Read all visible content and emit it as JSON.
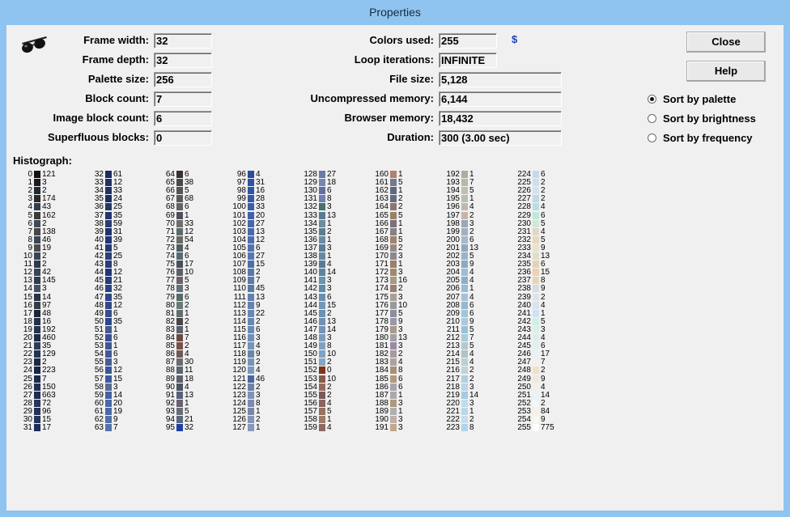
{
  "window": {
    "title": "Properties"
  },
  "fields_left": [
    {
      "label": "Frame width:",
      "value": "32"
    },
    {
      "label": "Frame depth:",
      "value": "32"
    },
    {
      "label": "Palette size:",
      "value": "256"
    },
    {
      "label": "Block count:",
      "value": "7"
    },
    {
      "label": "Image block count:",
      "value": "6"
    },
    {
      "label": "Superfluous blocks:",
      "value": "0"
    }
  ],
  "fields_mid": [
    {
      "label": "Colors used:",
      "value": "255"
    },
    {
      "label": "Loop iterations:",
      "value": "INFINITE"
    },
    {
      "label": "File size:",
      "value": "5,128"
    },
    {
      "label": "Uncompressed memory:",
      "value": "6,144"
    },
    {
      "label": "Browser memory:",
      "value": "18,432"
    },
    {
      "label": "Duration:",
      "value": "300 (3.00 sec)"
    }
  ],
  "dollar": "$",
  "buttons": {
    "close": "Close",
    "help": "Help"
  },
  "sort": {
    "selected": "palette",
    "options": [
      "Sort by palette",
      "Sort by brightness",
      "Sort by frequency"
    ]
  },
  "histograph": {
    "title": "Histograph:",
    "entries": [
      [
        "0",
        "#111111",
        "121"
      ],
      [
        "1",
        "#1c1c1c",
        "3"
      ],
      [
        "2",
        "#222a33",
        "2"
      ],
      [
        "3",
        "#2a2a2a",
        "174"
      ],
      [
        "4",
        "#333e4c",
        "43"
      ],
      [
        "5",
        "#3a3a3a",
        "162"
      ],
      [
        "6",
        "#404a58",
        "2"
      ],
      [
        "7",
        "#474747",
        "138"
      ],
      [
        "8",
        "#3d4656",
        "46"
      ],
      [
        "9",
        "#4c4c4c",
        "19"
      ],
      [
        "10",
        "#39464f",
        "2"
      ],
      [
        "11",
        "#2c3a4a",
        "2"
      ],
      [
        "12",
        "#374554",
        "42"
      ],
      [
        "13",
        "#2e3c52",
        "145"
      ],
      [
        "14",
        "#445264",
        "3"
      ],
      [
        "15",
        "#2b3542",
        "14"
      ],
      [
        "16",
        "#353c46",
        "97"
      ],
      [
        "17",
        "#1c2633",
        "48"
      ],
      [
        "18",
        "#22324a",
        "16"
      ],
      [
        "19",
        "#26344c",
        "192"
      ],
      [
        "20",
        "#1f2b44",
        "460"
      ],
      [
        "21",
        "#2c3b56",
        "35"
      ],
      [
        "22",
        "#243352",
        "129"
      ],
      [
        "23",
        "#1e2a45",
        "2"
      ],
      [
        "24",
        "#1a2645",
        "223"
      ],
      [
        "25",
        "#1d2b52",
        "7"
      ],
      [
        "26",
        "#222f52",
        "150"
      ],
      [
        "27",
        "#1f2c4f",
        "663"
      ],
      [
        "28",
        "#283459",
        "72"
      ],
      [
        "29",
        "#233057",
        "96"
      ],
      [
        "30",
        "#27335b",
        "15"
      ],
      [
        "31",
        "#1e2c5c",
        "17"
      ],
      [
        "32",
        "#1c2c60",
        "61"
      ],
      [
        "33",
        "#223160",
        "12"
      ],
      [
        "34",
        "#1f3367",
        "33"
      ],
      [
        "35",
        "#1b2d68",
        "24"
      ],
      [
        "36",
        "#263769",
        "25"
      ],
      [
        "37",
        "#22356d",
        "35"
      ],
      [
        "38",
        "#2c3c6c",
        "59"
      ],
      [
        "39",
        "#1e3270",
        "31"
      ],
      [
        "40",
        "#213674",
        "39"
      ],
      [
        "41",
        "#243a76",
        "5"
      ],
      [
        "42",
        "#2b3f78",
        "25"
      ],
      [
        "43",
        "#283c7a",
        "8"
      ],
      [
        "44",
        "#20367c",
        "12"
      ],
      [
        "45",
        "#263d80",
        "21"
      ],
      [
        "46",
        "#2b4284",
        "32"
      ],
      [
        "47",
        "#2e4686",
        "35"
      ],
      [
        "48",
        "#334a8a",
        "12"
      ],
      [
        "49",
        "#3a4f88",
        "6"
      ],
      [
        "50",
        "#2f478c",
        "35"
      ],
      [
        "51",
        "#475a8a",
        "1"
      ],
      [
        "52",
        "#3a5090",
        "6"
      ],
      [
        "53",
        "#3f5696",
        "1"
      ],
      [
        "54",
        "#425a96",
        "6"
      ],
      [
        "55",
        "#465d98",
        "3"
      ],
      [
        "56",
        "#3a579c",
        "12"
      ],
      [
        "57",
        "#3e5ba0",
        "15"
      ],
      [
        "58",
        "#5a6c94",
        "3"
      ],
      [
        "59",
        "#4462a4",
        "14"
      ],
      [
        "60",
        "#4b67a6",
        "20"
      ],
      [
        "61",
        "#4c68a8",
        "19"
      ],
      [
        "62",
        "#5370aa",
        "9"
      ],
      [
        "63",
        "#5673ae",
        "7"
      ],
      [
        "64",
        "#3b3030",
        "6"
      ],
      [
        "65",
        "#4a4a4a",
        "38"
      ],
      [
        "66",
        "#555555",
        "5"
      ],
      [
        "67",
        "#5a5a5a",
        "68"
      ],
      [
        "68",
        "#646464",
        "6"
      ],
      [
        "69",
        "#4f4f59",
        "1"
      ],
      [
        "70",
        "#6e6e6e",
        "33"
      ],
      [
        "71",
        "#5c6c6c",
        "12"
      ],
      [
        "72",
        "#6a6a64",
        "54"
      ],
      [
        "73",
        "#4f5e5e",
        "4"
      ],
      [
        "74",
        "#5a6a73",
        "6"
      ],
      [
        "75",
        "#464f5b",
        "17"
      ],
      [
        "76",
        "#5e5e66",
        "10"
      ],
      [
        "77",
        "#6a6268",
        "5"
      ],
      [
        "78",
        "#647080",
        "3"
      ],
      [
        "79",
        "#566a6a",
        "6"
      ],
      [
        "80",
        "#6a7a74",
        "2"
      ],
      [
        "81",
        "#607070",
        "1"
      ],
      [
        "82",
        "#4a4548",
        "2"
      ],
      [
        "83",
        "#5a606e",
        "1"
      ],
      [
        "84",
        "#6c4a40",
        "7"
      ],
      [
        "85",
        "#7a5048",
        "2"
      ],
      [
        "86",
        "#6e5a5a",
        "4"
      ],
      [
        "87",
        "#6a6c70",
        "30"
      ],
      [
        "88",
        "#5c6574",
        "11"
      ],
      [
        "89",
        "#5e606e",
        "18"
      ],
      [
        "90",
        "#4a5460",
        "4"
      ],
      [
        "91",
        "#58607a",
        "13"
      ],
      [
        "92",
        "#6c6070",
        "1"
      ],
      [
        "93",
        "#6a6c7c",
        "5"
      ],
      [
        "94",
        "#5a6680",
        "21"
      ],
      [
        "95",
        "#1f3fa4",
        "32"
      ],
      [
        "96",
        "#2a4aa0",
        "4"
      ],
      [
        "97",
        "#3250a4",
        "31"
      ],
      [
        "98",
        "#2c56a8",
        "16"
      ],
      [
        "99",
        "#3a58a2",
        "28"
      ],
      [
        "100",
        "#3c5ea8",
        "33"
      ],
      [
        "101",
        "#4460a8",
        "20"
      ],
      [
        "102",
        "#4866a8",
        "27"
      ],
      [
        "103",
        "#4a68aa",
        "13"
      ],
      [
        "104",
        "#4f6caa",
        "12"
      ],
      [
        "105",
        "#5272ac",
        "6"
      ],
      [
        "106",
        "#5776b0",
        "27"
      ],
      [
        "107",
        "#4a70a8",
        "15"
      ],
      [
        "108",
        "#5a76aa",
        "2"
      ],
      [
        "109",
        "#5c7ab0",
        "7"
      ],
      [
        "110",
        "#587aa8",
        "45"
      ],
      [
        "111",
        "#6080b2",
        "13"
      ],
      [
        "112",
        "#6482b2",
        "9"
      ],
      [
        "113",
        "#6a86b4",
        "22"
      ],
      [
        "114",
        "#6688b4",
        "2"
      ],
      [
        "115",
        "#6c8ab6",
        "6"
      ],
      [
        "116",
        "#7090b8",
        "3"
      ],
      [
        "117",
        "#7494ba",
        "4"
      ],
      [
        "118",
        "#6a86a8",
        "9"
      ],
      [
        "119",
        "#7a94b8",
        "2"
      ],
      [
        "120",
        "#7e98bc",
        "4"
      ],
      [
        "121",
        "#4a66a0",
        "46"
      ],
      [
        "122",
        "#7082a8",
        "2"
      ],
      [
        "123",
        "#8092b8",
        "3"
      ],
      [
        "124",
        "#808ab0",
        "8"
      ],
      [
        "125",
        "#7888a4",
        "1"
      ],
      [
        "126",
        "#8494b4",
        "2"
      ],
      [
        "127",
        "#8898b6",
        "1"
      ],
      [
        "128",
        "#6a7aa8",
        "27"
      ],
      [
        "129",
        "#7a86b0",
        "18"
      ],
      [
        "130",
        "#6070a0",
        "6"
      ],
      [
        "131",
        "#7080b0",
        "8"
      ],
      [
        "132",
        "#4a7070",
        "3"
      ],
      [
        "133",
        "#5a7c90",
        "13"
      ],
      [
        "134",
        "#6a8c9c",
        "1"
      ],
      [
        "135",
        "#5a8090",
        "2"
      ],
      [
        "136",
        "#6a8aa8",
        "1"
      ],
      [
        "137",
        "#5c7e94",
        "3"
      ],
      [
        "138",
        "#648aa0",
        "1"
      ],
      [
        "139",
        "#587c98",
        "4"
      ],
      [
        "140",
        "#5a84a4",
        "14"
      ],
      [
        "141",
        "#6a94b0",
        "3"
      ],
      [
        "142",
        "#5e8cac",
        "3"
      ],
      [
        "143",
        "#6890b0",
        "6"
      ],
      [
        "144",
        "#7098b8",
        "15"
      ],
      [
        "145",
        "#6a92b4",
        "2"
      ],
      [
        "146",
        "#7290b4",
        "13"
      ],
      [
        "147",
        "#7494b8",
        "14"
      ],
      [
        "148",
        "#7c9cbc",
        "3"
      ],
      [
        "149",
        "#80a0c0",
        "8"
      ],
      [
        "150",
        "#7ea2c2",
        "10"
      ],
      [
        "151",
        "#84a6c4",
        "2"
      ],
      [
        "152",
        "#7a3418",
        "0"
      ],
      [
        "153",
        "#8a5a48",
        "10"
      ],
      [
        "154",
        "#966a5a",
        "2"
      ],
      [
        "155",
        "#7a5a5a",
        "2"
      ],
      [
        "156",
        "#8a6460",
        "4"
      ],
      [
        "157",
        "#9a7060",
        "5"
      ],
      [
        "158",
        "#a07a68",
        "1"
      ],
      [
        "159",
        "#8a6a60",
        "4"
      ],
      [
        "160",
        "#b08070",
        "1"
      ],
      [
        "161",
        "#707a90",
        "5"
      ],
      [
        "162",
        "#606a7a",
        "1"
      ],
      [
        "163",
        "#686c80",
        "2"
      ],
      [
        "164",
        "#8a7870",
        "2"
      ],
      [
        "165",
        "#98806a",
        "5"
      ],
      [
        "166",
        "#7a7078",
        "1"
      ],
      [
        "167",
        "#8a8088",
        "1"
      ],
      [
        "168",
        "#a08270",
        "5"
      ],
      [
        "169",
        "#988a80",
        "2"
      ],
      [
        "170",
        "#8a8a8a",
        "3"
      ],
      [
        "171",
        "#9a8070",
        "1"
      ],
      [
        "172",
        "#a08a70",
        "3"
      ],
      [
        "173",
        "#a69a8a",
        "16"
      ],
      [
        "174",
        "#9a8070",
        "2"
      ],
      [
        "175",
        "#a8a098",
        "3"
      ],
      [
        "176",
        "#9a9a9a",
        "10"
      ],
      [
        "177",
        "#8a90a0",
        "5"
      ],
      [
        "178",
        "#9a98a8",
        "9"
      ],
      [
        "179",
        "#a89a88",
        "3"
      ],
      [
        "180",
        "#a4a0a8",
        "13"
      ],
      [
        "181",
        "#9a8aa8",
        "3"
      ],
      [
        "182",
        "#a89aa0",
        "2"
      ],
      [
        "183",
        "#b0a0a0",
        "4"
      ],
      [
        "184",
        "#a89078",
        "8"
      ],
      [
        "185",
        "#b09a80",
        "6"
      ],
      [
        "186",
        "#a8a4b0",
        "6"
      ],
      [
        "187",
        "#b0a8a8",
        "1"
      ],
      [
        "188",
        "#b09880",
        "3"
      ],
      [
        "189",
        "#b0b0b0",
        "1"
      ],
      [
        "190",
        "#bcb0a8",
        "3"
      ],
      [
        "191",
        "#c0a890",
        "3"
      ],
      [
        "192",
        "#a8b0a0",
        "1"
      ],
      [
        "193",
        "#b8b8a8",
        "7"
      ],
      [
        "194",
        "#c0c0b0",
        "5"
      ],
      [
        "195",
        "#b4c0b0",
        "1"
      ],
      [
        "196",
        "#c0b8b0",
        "4"
      ],
      [
        "197",
        "#c8b4a8",
        "2"
      ],
      [
        "198",
        "#98a8b8",
        "3"
      ],
      [
        "199",
        "#a0b0c0",
        "2"
      ],
      [
        "200",
        "#a8b8c8",
        "6"
      ],
      [
        "201",
        "#90a8c0",
        "13"
      ],
      [
        "202",
        "#9ab4c8",
        "5"
      ],
      [
        "203",
        "#8aaac8",
        "9"
      ],
      [
        "204",
        "#a0bcd0",
        "4"
      ],
      [
        "205",
        "#88b0d0",
        "4"
      ],
      [
        "206",
        "#9abcd4",
        "1"
      ],
      [
        "207",
        "#a8c0d4",
        "4"
      ],
      [
        "208",
        "#94b8d4",
        "6"
      ],
      [
        "209",
        "#a4c4d8",
        "6"
      ],
      [
        "210",
        "#b0c8d8",
        "9"
      ],
      [
        "211",
        "#98c0dc",
        "5"
      ],
      [
        "212",
        "#a8ccdc",
        "7"
      ],
      [
        "213",
        "#b4c8d0",
        "5"
      ],
      [
        "214",
        "#b0c4c0",
        "4"
      ],
      [
        "215",
        "#b8d0d8",
        "4"
      ],
      [
        "216",
        "#c0d4d8",
        "2"
      ],
      [
        "217",
        "#b0d0e0",
        "2"
      ],
      [
        "218",
        "#bcd4e4",
        "3"
      ],
      [
        "219",
        "#a4cce4",
        "14"
      ],
      [
        "220",
        "#c0dce8",
        "3"
      ],
      [
        "221",
        "#b8d8ec",
        "1"
      ],
      [
        "222",
        "#c8dcec",
        "2"
      ],
      [
        "223",
        "#b0d4ec",
        "8"
      ],
      [
        "224",
        "#c4d8f0",
        "6"
      ],
      [
        "225",
        "#c8e0f0",
        "2"
      ],
      [
        "226",
        "#d0e4f0",
        "2"
      ],
      [
        "227",
        "#c0d8e8",
        "2"
      ],
      [
        "228",
        "#b8e0e0",
        "4"
      ],
      [
        "229",
        "#c0e8d8",
        "6"
      ],
      [
        "230",
        "#d0e8d8",
        "5"
      ],
      [
        "231",
        "#e0d8c8",
        "4"
      ],
      [
        "232",
        "#e8d8c0",
        "5"
      ],
      [
        "233",
        "#e8e0d0",
        "9"
      ],
      [
        "234",
        "#e0e0c8",
        "13"
      ],
      [
        "235",
        "#e8d0b8",
        "6"
      ],
      [
        "236",
        "#f0d0b0",
        "15"
      ],
      [
        "237",
        "#e8d4b8",
        "8"
      ],
      [
        "238",
        "#d8dce0",
        "9"
      ],
      [
        "239",
        "#e0e4e8",
        "2"
      ],
      [
        "240",
        "#d8e4f0",
        "4"
      ],
      [
        "241",
        "#d0e0f8",
        "1"
      ],
      [
        "242",
        "#d0f0e0",
        "5"
      ],
      [
        "243",
        "#d8f0e8",
        "3"
      ],
      [
        "244",
        "#e0ece8",
        "4"
      ],
      [
        "245",
        "#e0f0f0",
        "6"
      ],
      [
        "246",
        "#e8f0f8",
        "17"
      ],
      [
        "247",
        "#f0f0f0",
        "7"
      ],
      [
        "248",
        "#f0e0c8",
        "2"
      ],
      [
        "249",
        "#f0e8d8",
        "9"
      ],
      [
        "250",
        "#f4f0e8",
        "4"
      ],
      [
        "251",
        "#e8f4f4",
        "14"
      ],
      [
        "252",
        "#f0f8f8",
        "2"
      ],
      [
        "253",
        "#f8f0e8",
        "84"
      ],
      [
        "254",
        "#f8f8f0",
        "9"
      ],
      [
        "255",
        "#ffffff",
        "775"
      ]
    ]
  }
}
